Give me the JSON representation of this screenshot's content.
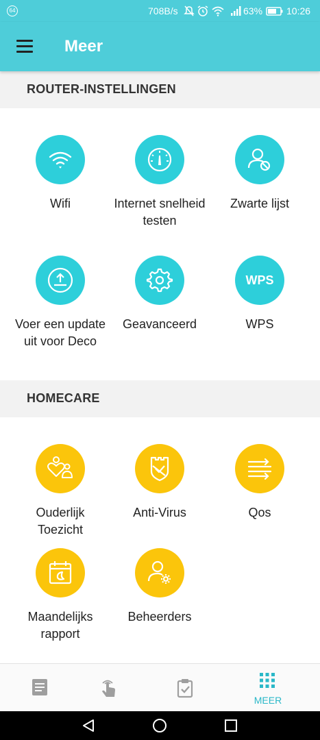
{
  "status_bar": {
    "badge": "64",
    "net_speed": "708B/s",
    "battery_percent": "63%",
    "time": "10:26"
  },
  "app_bar": {
    "title": "Meer"
  },
  "router_section": {
    "header": "ROUTER-INSTELLINGEN",
    "items": [
      {
        "label": "Wifi",
        "icon": "wifi-icon"
      },
      {
        "label": "Internet snelheid testen",
        "icon": "speedometer-icon"
      },
      {
        "label": "Zwarte lijst",
        "icon": "blocked-user-icon"
      },
      {
        "label": "Voer een update uit voor Deco",
        "icon": "firmware-upload-icon"
      },
      {
        "label": "Geavanceerd",
        "icon": "gear-icon"
      },
      {
        "label": "WPS",
        "icon": "wps-icon",
        "icon_text": "WPS"
      }
    ]
  },
  "homecare_section": {
    "header": "HOMECARE",
    "items": [
      {
        "label": "Ouderlijk Toezicht",
        "icon": "parental-control-icon"
      },
      {
        "label": "Anti-Virus",
        "icon": "shield-icon"
      },
      {
        "label": "Qos",
        "icon": "qos-icon"
      },
      {
        "label": "Maandelijks rapport",
        "icon": "calendar-report-icon"
      },
      {
        "label": "Beheerders",
        "icon": "admin-gear-icon"
      }
    ]
  },
  "bottom_nav": {
    "items": [
      {
        "label": "",
        "icon": "overview-icon"
      },
      {
        "label": "",
        "icon": "touch-icon"
      },
      {
        "label": "",
        "icon": "clipboard-check-icon"
      },
      {
        "label": "MEER",
        "icon": "grid-icon"
      }
    ],
    "active_index": 3
  },
  "colors": {
    "accent": "#4ecdd9",
    "teal_icon": "#2dcfda",
    "yellow_icon": "#fbc50b"
  }
}
